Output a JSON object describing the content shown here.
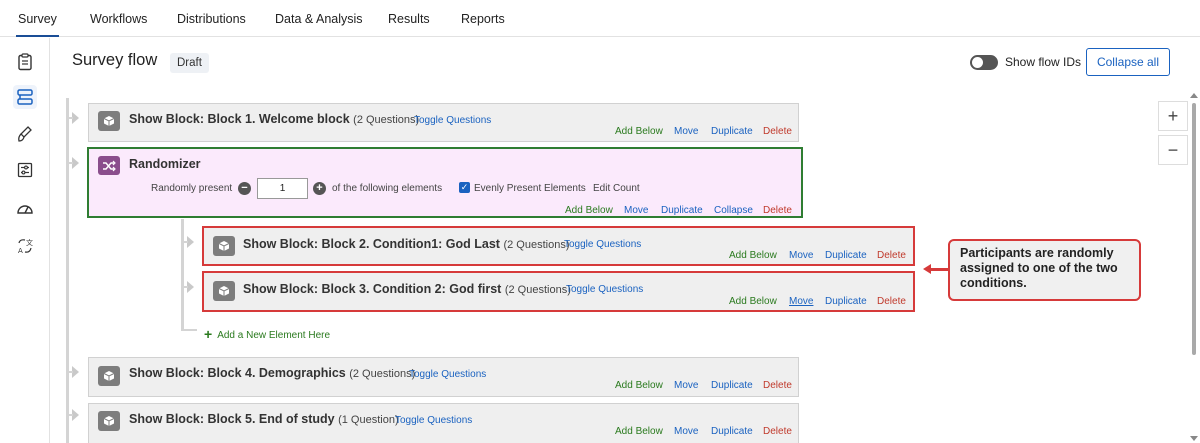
{
  "nav": {
    "tabs": [
      "Survey",
      "Workflows",
      "Distributions",
      "Data & Analysis",
      "Results",
      "Reports"
    ],
    "active_tab": "Survey"
  },
  "rail": {
    "icons": [
      "survey-questions-icon",
      "survey-flow-icon",
      "look-and-feel-icon",
      "survey-options-icon",
      "dashboard-icon",
      "translate-icon"
    ]
  },
  "header": {
    "title": "Survey flow",
    "badge": "Draft",
    "show_flow_ids": "Show flow IDs",
    "collapse_all": "Collapse all"
  },
  "actions": {
    "add_below": "Add Below",
    "move": "Move",
    "duplicate": "Duplicate",
    "collapse": "Collapse",
    "delete": "Delete",
    "toggle_questions": "Toggle Questions"
  },
  "blocks": [
    {
      "title": "Show Block: Block 1. Welcome block",
      "count": "(2 Questions)"
    },
    {
      "title": "Show Block: Block 2. Condition1: God Last",
      "count": "(2 Questions)"
    },
    {
      "title": "Show Block: Block 3. Condition 2: God first",
      "count": "(2 Questions)"
    },
    {
      "title": "Show Block: Block 4. Demographics",
      "count": "(2 Questions)"
    },
    {
      "title": "Show Block: Block 5. End of study",
      "count": "(1 Question)"
    }
  ],
  "randomizer": {
    "title": "Randomizer",
    "randomly_present": "Randomly present",
    "count_value": "1",
    "of_following": "of the following elements",
    "evenly_present": "Evenly Present Elements",
    "edit_count": "Edit Count"
  },
  "add_new_element": "Add a New Element Here",
  "callout": "Participants are randomly assigned to one of the two conditions.",
  "colors": {
    "accent": "#1a62c0",
    "add_green": "#2a7a1e",
    "delete_red": "#c0392b",
    "randomizer_border": "#2f7d32",
    "randomizer_bg": "#fbeafc",
    "highlight_red": "#d63a3a"
  }
}
